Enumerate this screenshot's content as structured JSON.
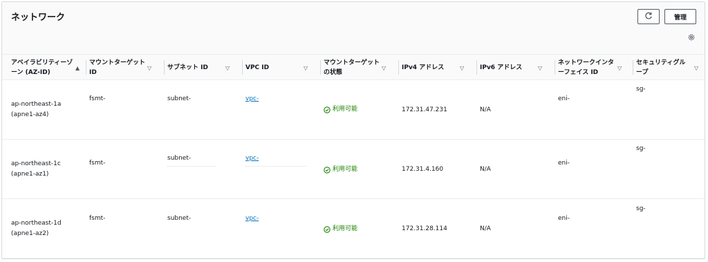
{
  "header": {
    "title": "ネットワーク",
    "manage_label": "管理"
  },
  "columns": [
    {
      "label": "アベイラビリティーゾーン (AZ-ID)",
      "sort": "▲"
    },
    {
      "label": "マウントターゲット ID",
      "sort": "▽"
    },
    {
      "label": "サブネット ID",
      "sort": "▽"
    },
    {
      "label": "VPC ID",
      "sort": "▽"
    },
    {
      "label": "マウントターゲットの状態",
      "sort": "▽"
    },
    {
      "label": "IPv4 アドレス",
      "sort": "▽"
    },
    {
      "label": "IPv6 アドレス",
      "sort": "▽"
    },
    {
      "label": "ネットワークインターフェイス ID",
      "sort": "▽"
    },
    {
      "label": "セキュリティグループ",
      "sort": "▽"
    }
  ],
  "rows": [
    {
      "az": "ap-northeast-1a",
      "az_id": "(apne1-az4)",
      "mount_target": "fsmt-",
      "subnet": "subnet-",
      "vpc": "vpc-",
      "state": "利用可能",
      "ipv4": "172.31.47.231",
      "ipv6": "N/A",
      "eni": "eni-",
      "sg": "sg-"
    },
    {
      "az": "ap-northeast-1c",
      "az_id": "(apne1-az1)",
      "mount_target": "fsmt-",
      "subnet": "subnet-",
      "vpc": "vpc-",
      "state": "利用可能",
      "ipv4": "172.31.4.160",
      "ipv6": "N/A",
      "eni": "eni-",
      "sg": "sg-"
    },
    {
      "az": "ap-northeast-1d",
      "az_id": "(apne1-az2)",
      "mount_target": "fsmt-",
      "subnet": "subnet-",
      "vpc": "vpc-",
      "state": "利用可能",
      "ipv4": "172.31.28.114",
      "ipv6": "N/A",
      "eni": "eni-",
      "sg": "sg-"
    }
  ],
  "icons": {
    "refresh": "refresh-icon",
    "settings": "gear-icon",
    "status": "check-circle-icon"
  },
  "colors": {
    "link": "#0073bb",
    "status_ok": "#1d8102",
    "border": "#d5dbdb"
  }
}
